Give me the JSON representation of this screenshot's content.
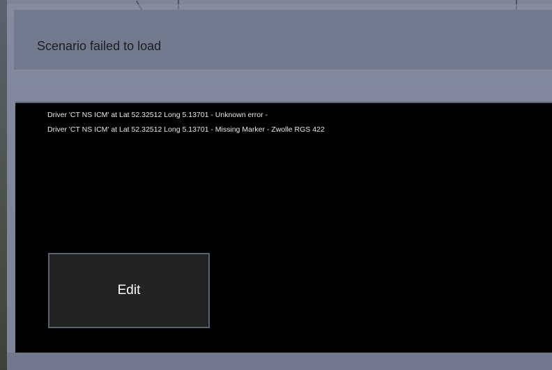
{
  "dialog": {
    "title": "Scenario failed to load",
    "messages": [
      "Driver 'CT NS ICM' at Lat 52.32512 Long 5.13701 - Unknown error -",
      "Driver 'CT NS ICM' at Lat 52.32512 Long 5.13701 - Missing Marker - Zwolle RGS 422"
    ],
    "edit_label": "Edit"
  },
  "colors": {
    "panel_background": "#000000",
    "header_background": "#747a8e",
    "button_background": "#222222",
    "button_border": "#5d6275",
    "message_text": "#e8e8e8"
  }
}
